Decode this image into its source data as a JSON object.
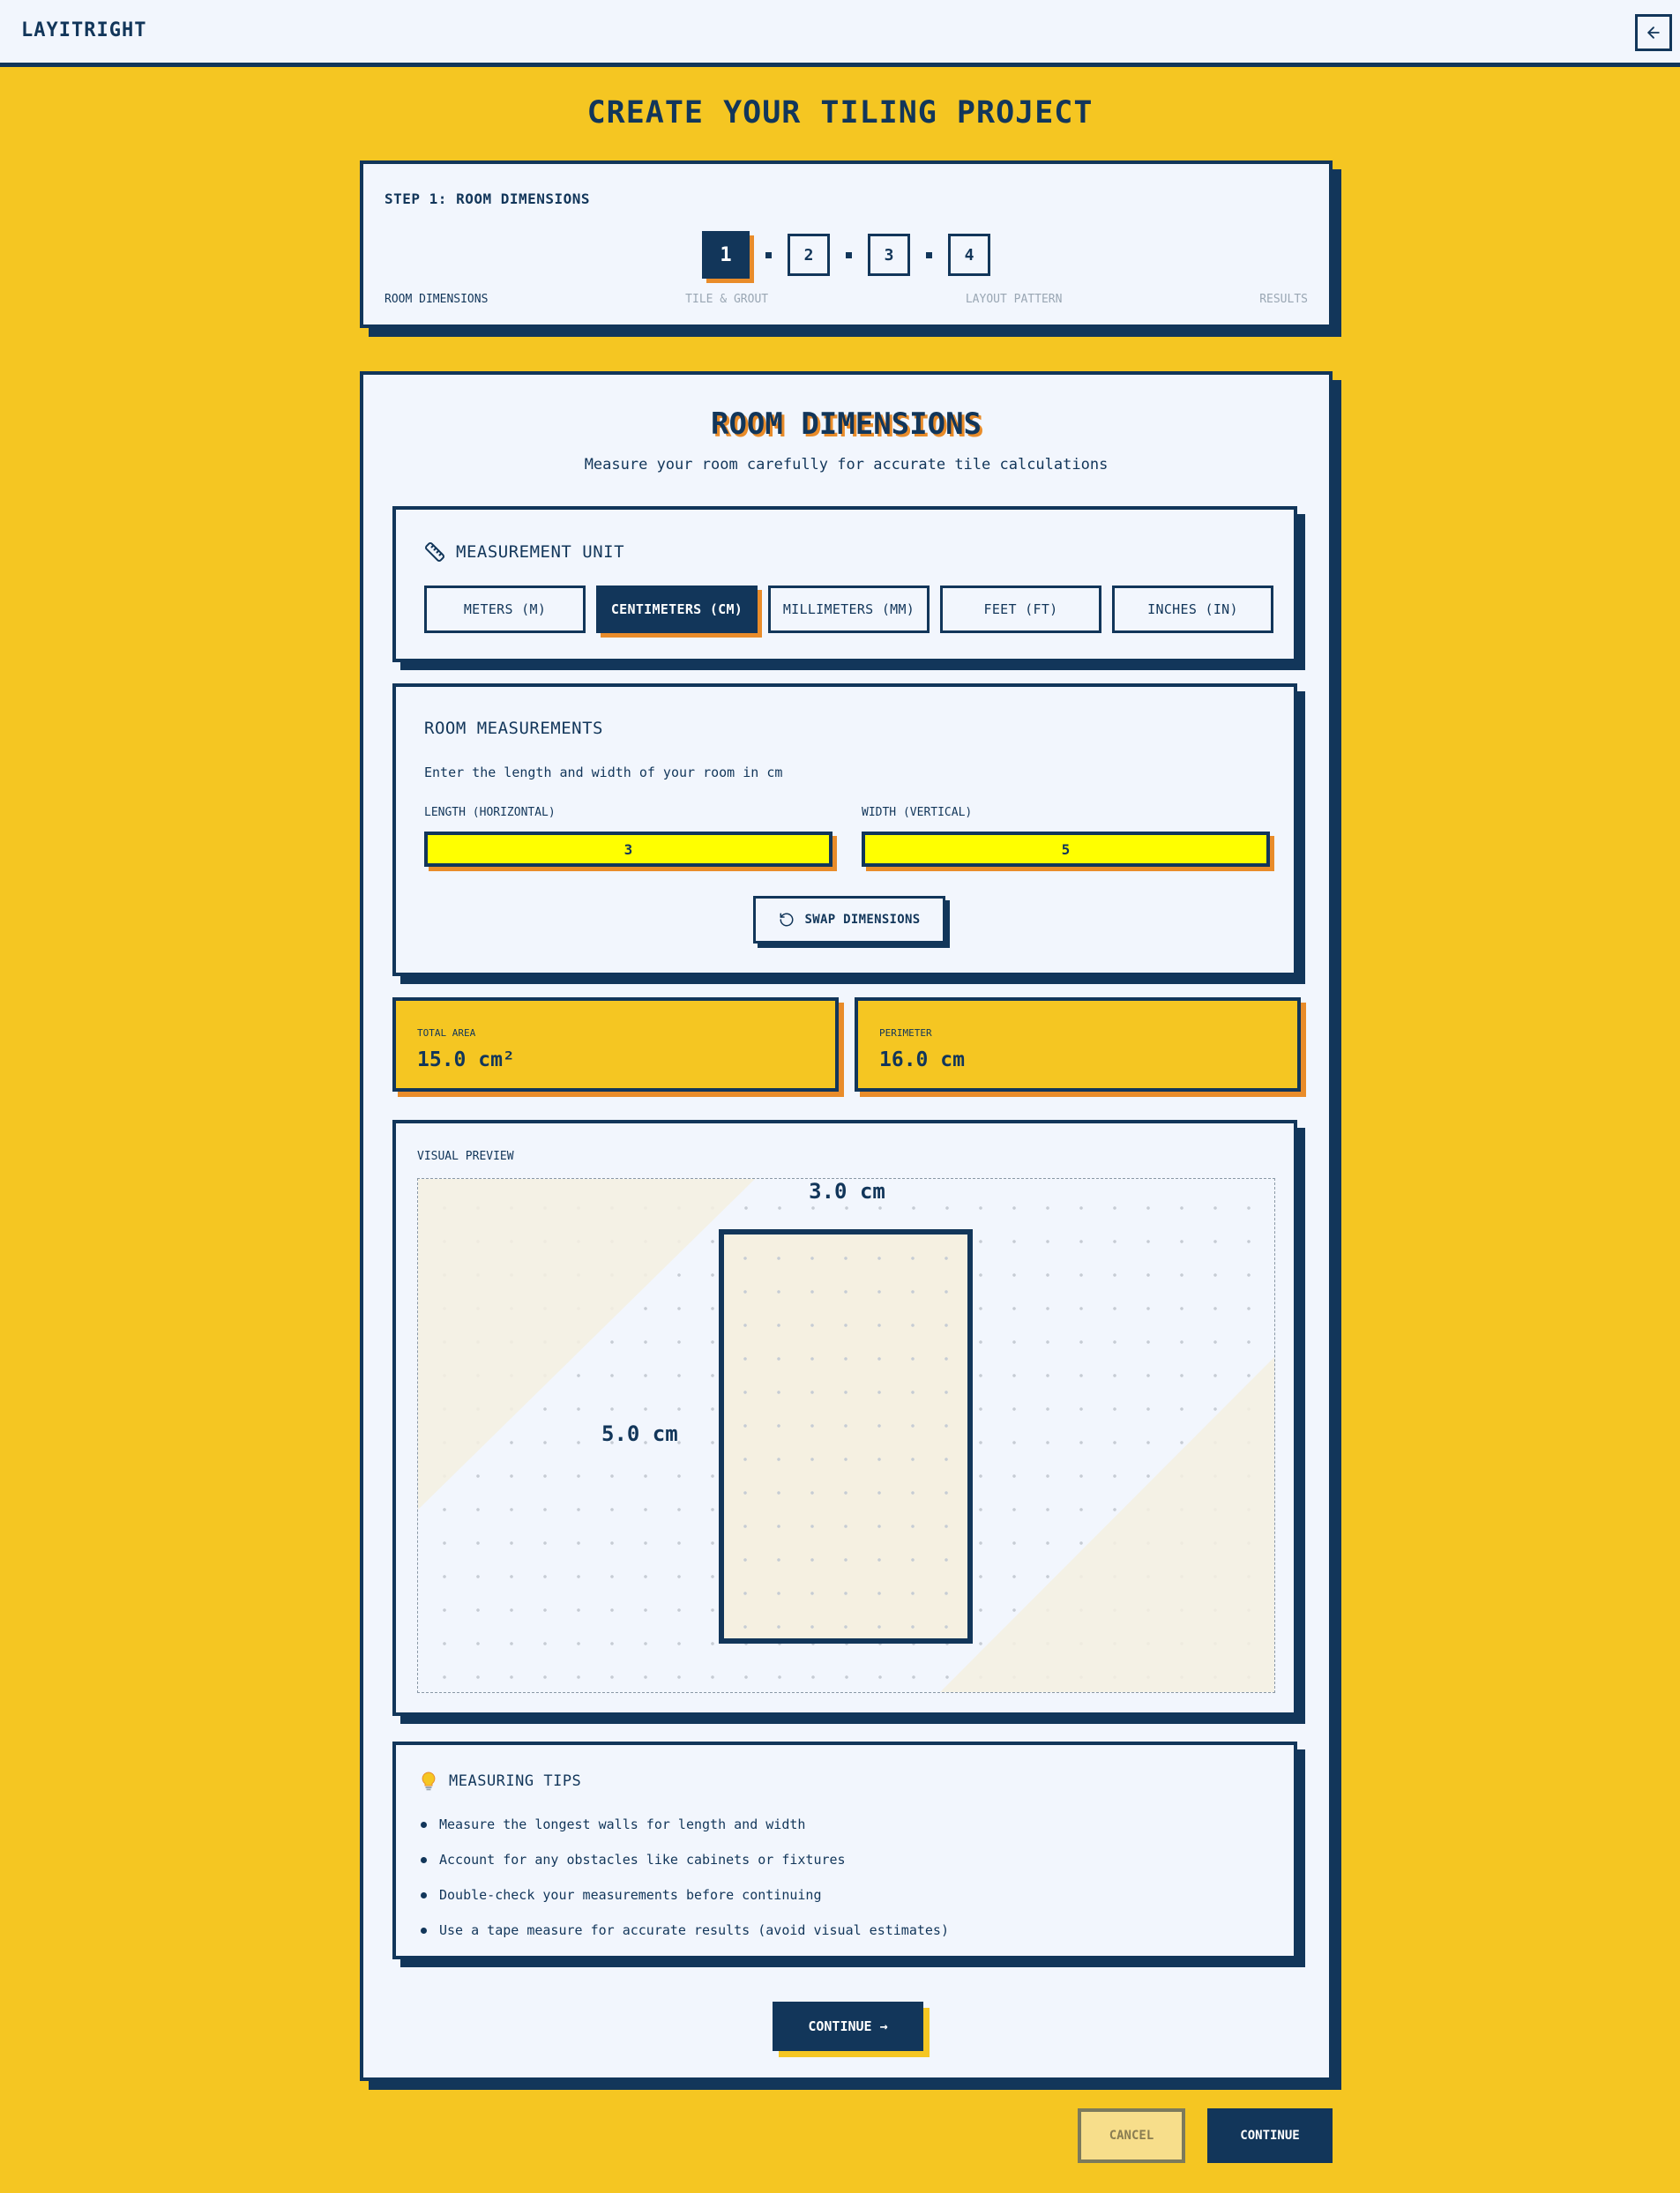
{
  "header": {
    "brand": "LAYITRIGHT",
    "back_icon": "arrow-left-icon"
  },
  "page_title": "CREATE YOUR TILING PROJECT",
  "stepper": {
    "label": "STEP 1: ROOM DIMENSIONS",
    "steps": [
      {
        "number": "1",
        "name": "ROOM DIMENSIONS",
        "active": true
      },
      {
        "number": "2",
        "name": "TILE & GROUT",
        "active": false
      },
      {
        "number": "3",
        "name": "LAYOUT PATTERN",
        "active": false
      },
      {
        "number": "4",
        "name": "RESULTS",
        "active": false
      }
    ]
  },
  "main": {
    "title": "ROOM DIMENSIONS",
    "subtitle": "Measure your room carefully for accurate tile calculations",
    "unit": {
      "heading": "MEASUREMENT UNIT",
      "icon": "ruler-icon",
      "options": [
        "METERS (M)",
        "CENTIMETERS (CM)",
        "MILLIMETERS (MM)",
        "FEET (FT)",
        "INCHES (IN)"
      ],
      "selected": "CENTIMETERS (CM)"
    },
    "measurements": {
      "heading": "ROOM MEASUREMENTS",
      "description": "Enter the length and width of your room in cm",
      "length_label": "LENGTH (HORIZONTAL)",
      "length_value": "3",
      "width_label": "WIDTH (VERTICAL)",
      "width_value": "5",
      "swap_label": "SWAP DIMENSIONS",
      "swap_icon": "rotate-icon"
    },
    "stats": {
      "area_label": "TOTAL AREA",
      "area_value": "15.0 cm²",
      "perimeter_label": "PERIMETER",
      "perimeter_value": "16.0 cm"
    },
    "preview": {
      "label": "VISUAL PREVIEW",
      "length_dim": "3.0 cm",
      "width_dim": "5.0 cm"
    },
    "tips": {
      "heading": "MEASURING TIPS",
      "icon": "lightbulb-icon",
      "items": [
        "Measure the longest walls for length and width",
        "Account for any obstacles like cabinets or fixtures",
        "Double-check your measurements before continuing",
        "Use a tape measure for accurate results (avoid visual estimates)"
      ]
    },
    "continue_label": "CONTINUE →"
  },
  "footer": {
    "cancel_label": "CANCEL",
    "continue_label": "CONTINUE"
  },
  "colors": {
    "navy": "#12365a",
    "yellow": "#f5c622",
    "cream": "#f2f6fd",
    "orange": "#e98c2a",
    "input": "#ffff00"
  }
}
